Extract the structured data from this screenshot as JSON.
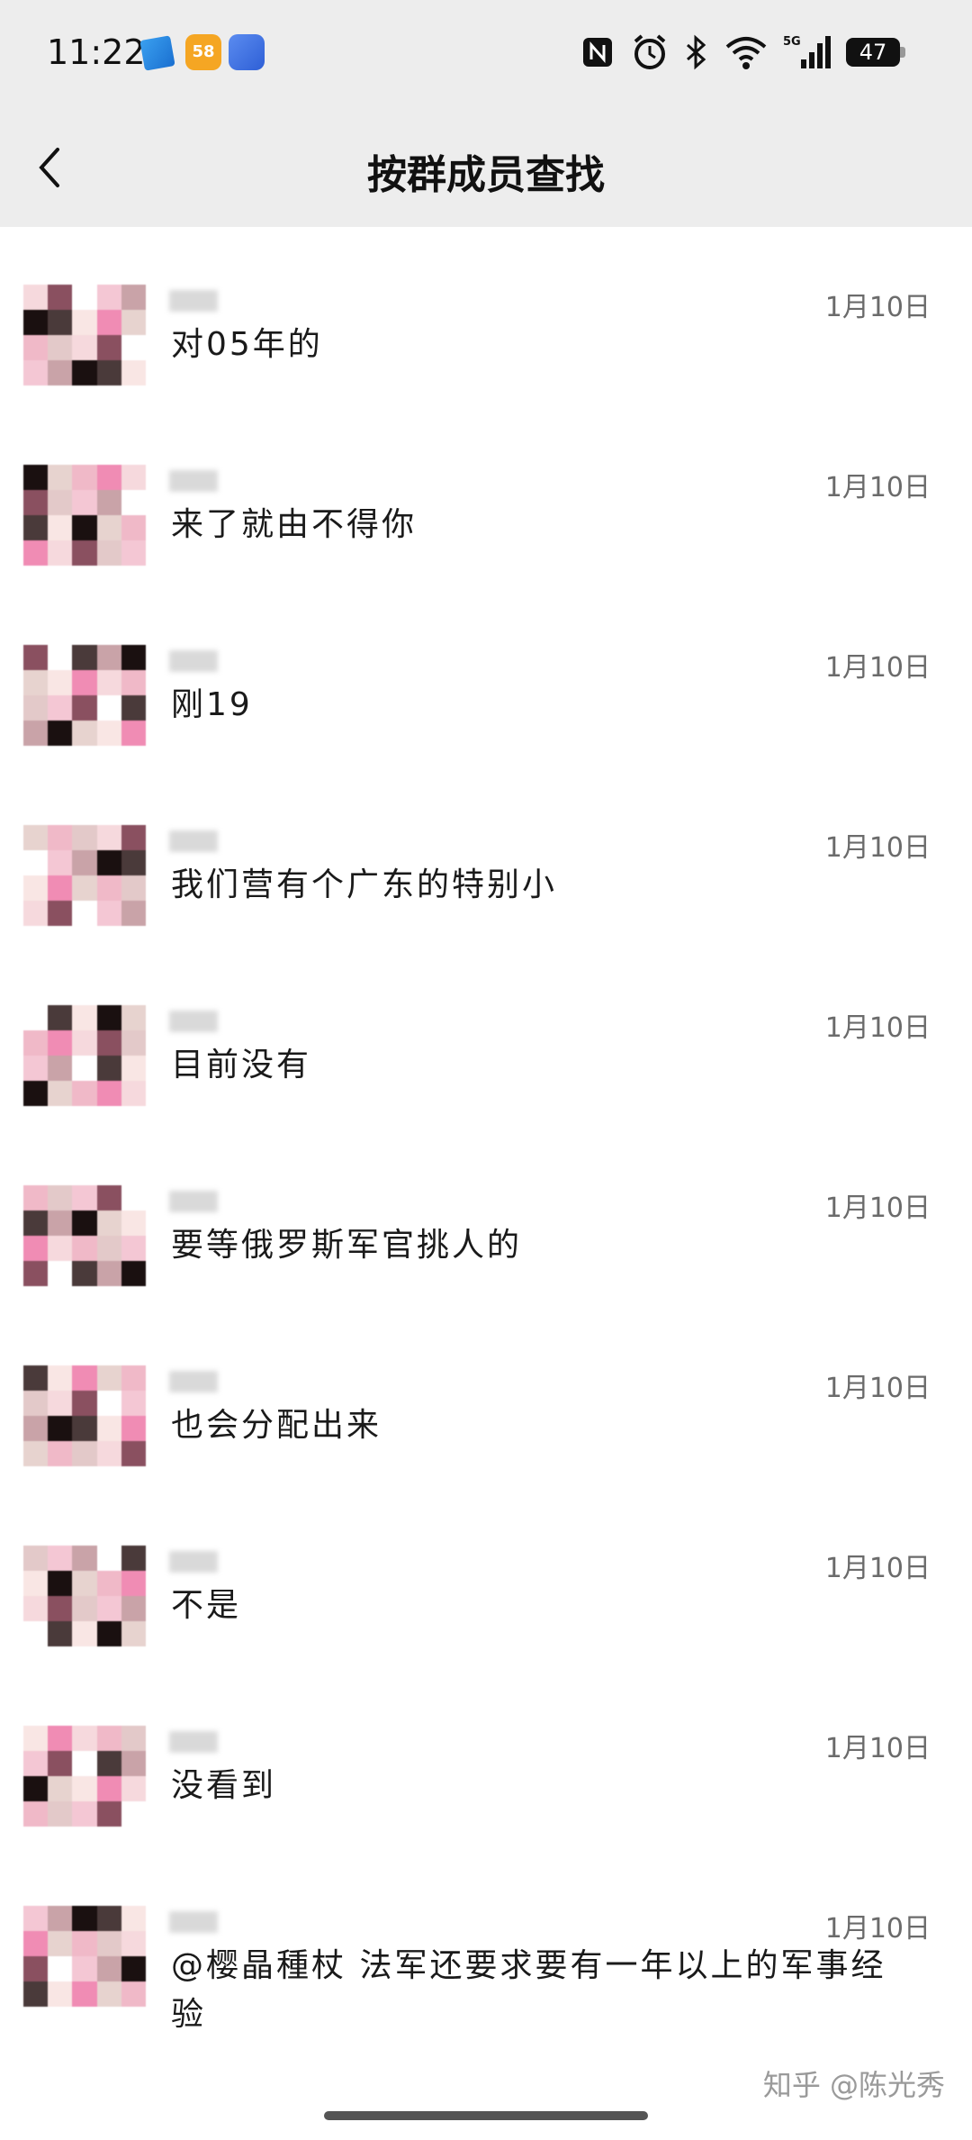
{
  "status_bar": {
    "time": "11:22",
    "app_icons": [
      "navigation-app-icon",
      "58-app-icon",
      "cloud-app-icon"
    ],
    "system_icons": [
      "nfc-icon",
      "alarm-icon",
      "bluetooth-icon",
      "wifi-icon",
      "5g-signal-icon"
    ],
    "network": "5G",
    "battery": "47"
  },
  "header": {
    "title": "按群成员查找",
    "back_icon": "chevron-left-icon"
  },
  "messages": [
    {
      "text": "对05年的",
      "date": "1月10日"
    },
    {
      "text": "来了就由不得你",
      "date": "1月10日"
    },
    {
      "text": "刚19",
      "date": "1月10日"
    },
    {
      "text": "我们营有个广东的特别小",
      "date": "1月10日"
    },
    {
      "text": "目前没有",
      "date": "1月10日"
    },
    {
      "text": "要等俄罗斯军官挑人的",
      "date": "1月10日"
    },
    {
      "text": "也会分配出来",
      "date": "1月10日"
    },
    {
      "text": "不是",
      "date": "1月10日"
    },
    {
      "text": "没看到",
      "date": "1月10日"
    },
    {
      "text": "@樱晶種杖 法军还要求要有一年以上的军事经验",
      "date": "1月10日"
    }
  ],
  "watermark": "知乎 @陈光秀",
  "colors": {
    "header_bg": "#ededed",
    "date_text": "#6b6b6b",
    "avatar_pink": "#f08cb4"
  }
}
